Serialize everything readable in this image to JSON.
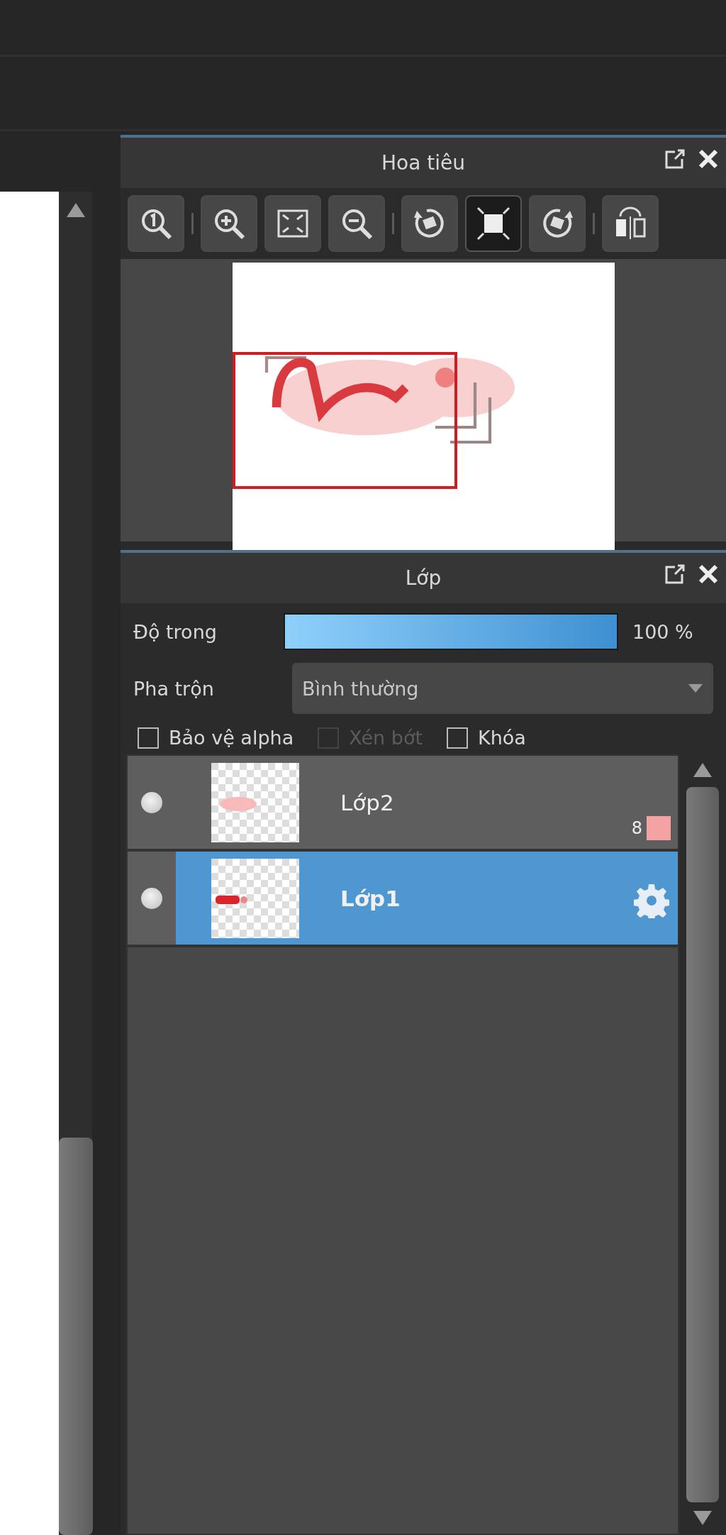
{
  "navigator": {
    "title": "Hoa tiêu",
    "tool_groups": [
      [
        {
          "selected": false
        }
      ],
      [
        {
          "selected": false
        },
        {
          "selected": false
        },
        {
          "selected": false
        }
      ],
      [
        {
          "selected": false
        },
        {
          "selected": true
        },
        {
          "selected": false
        }
      ],
      [
        {
          "selected": false
        }
      ]
    ],
    "preview": {
      "kind": "picture"
    }
  },
  "layers_panel": {
    "title": "Lớp",
    "opacity": {
      "label": "Độ trong",
      "level": 1,
      "reading": "100 %"
    },
    "blend": {
      "label": "Pha trộn",
      "value": "Bình thường"
    },
    "options": [
      {
        "label": "Bảo vệ alpha",
        "checked": false,
        "disabled": false
      },
      {
        "label": "Xén bớt",
        "checked": false,
        "disabled": true
      },
      {
        "label": "Khóa",
        "checked": false,
        "disabled": false
      }
    ],
    "layers": [
      {
        "name": "Lớp2",
        "selected": false,
        "badge": "8",
        "color": "#f4a3a3"
      },
      {
        "name": "Lớp1",
        "selected": true
      }
    ]
  }
}
